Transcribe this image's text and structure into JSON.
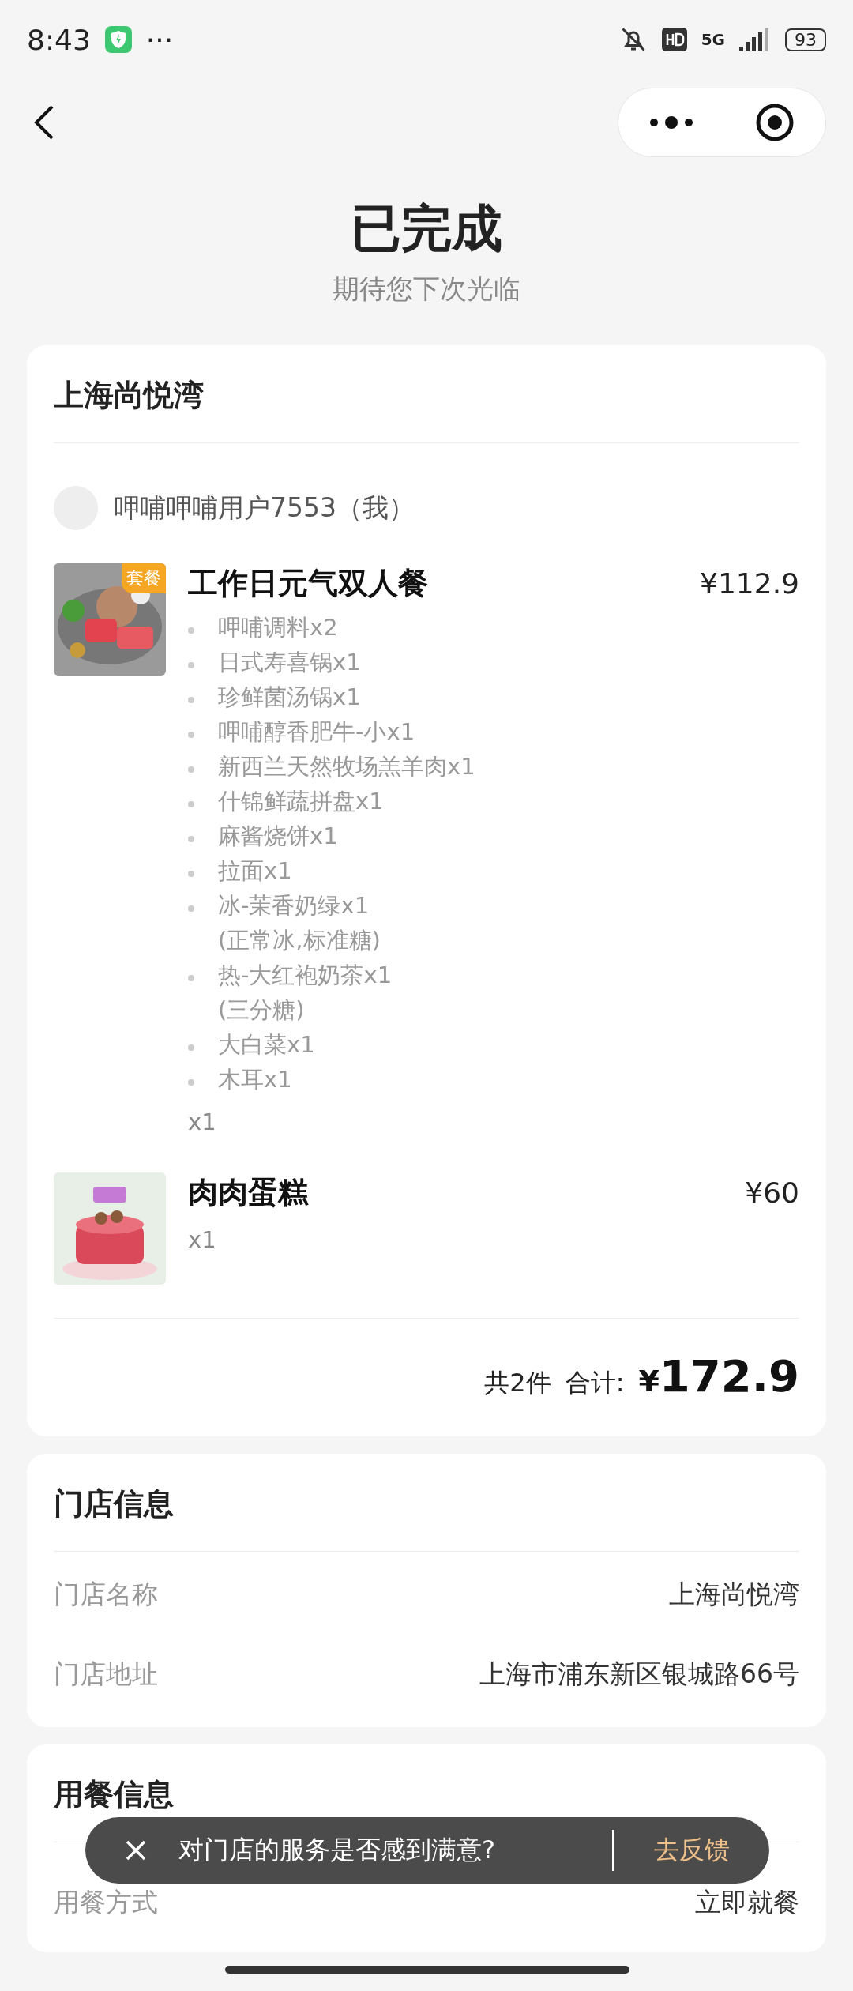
{
  "status_bar": {
    "time": "8:43",
    "more": "···",
    "network": "5G",
    "battery": "93"
  },
  "header": {
    "title": "已完成",
    "subtitle": "期待您下次光临"
  },
  "order": {
    "store": "上海尚悦湾",
    "user": "呷哺呷哺用户7553（我）",
    "items": [
      {
        "name": "工作日元气双人餐",
        "price": "¥112.9",
        "badge": "套餐",
        "qty": "x1",
        "sub_items": [
          {
            "name": "呷哺调料x2"
          },
          {
            "name": "日式寿喜锅x1"
          },
          {
            "name": "珍鲜菌汤锅x1"
          },
          {
            "name": "呷哺醇香肥牛-小x1"
          },
          {
            "name": "新西兰天然牧场羔羊肉x1"
          },
          {
            "name": "什锦鲜蔬拼盘x1"
          },
          {
            "name": "麻酱烧饼x1"
          },
          {
            "name": "拉面x1"
          },
          {
            "name": "冰-茉香奶绿x1",
            "note": "(正常冰,标准糖)"
          },
          {
            "name": "热-大红袍奶茶x1",
            "note": "(三分糖)"
          },
          {
            "name": "大白菜x1"
          },
          {
            "name": "木耳x1"
          }
        ]
      },
      {
        "name": "肉肉蛋糕",
        "price": "¥60",
        "qty": "x1"
      }
    ],
    "count": "共2件",
    "total_label": "合计:",
    "currency": "¥",
    "total": "172.9"
  },
  "store_info": {
    "title": "门店信息",
    "rows": [
      {
        "label": "门店名称",
        "value": "上海尚悦湾"
      },
      {
        "label": "门店地址",
        "value": "上海市浦东新区银城路66号"
      }
    ]
  },
  "dining_info": {
    "title": "用餐信息",
    "rows": [
      {
        "label": "用餐方式",
        "value": "立即就餐"
      }
    ]
  },
  "toast": {
    "text": "对门店的服务是否感到满意?",
    "action": "去反馈"
  }
}
